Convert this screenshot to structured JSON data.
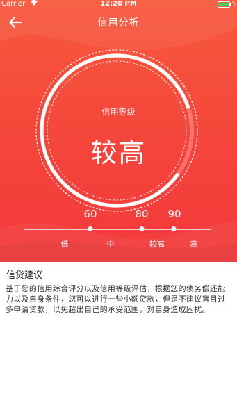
{
  "status_bar": {
    "carrier": "Carrier",
    "time": "12:20 PM"
  },
  "nav": {
    "title": "信用分析",
    "back_icon": "arrow-left-icon"
  },
  "rating": {
    "label": "信用等级",
    "value": "较高"
  },
  "scale": {
    "marks": [
      "60",
      "80",
      "90"
    ],
    "levels": [
      "低",
      "中",
      "较高",
      "高"
    ]
  },
  "advice": {
    "title": "信贷建议",
    "text": "基于您的信用综合评分以及信用等级评估，根据您的债务偿还能力以及自身条件，您可以进行一些小额贷款，但是不建议盲目过多申请贷款，以免超出自己的承受范围，对自身造成困扰。"
  },
  "colors": {
    "brand_red": "#f4453b",
    "battery_green": "#36d35b"
  }
}
